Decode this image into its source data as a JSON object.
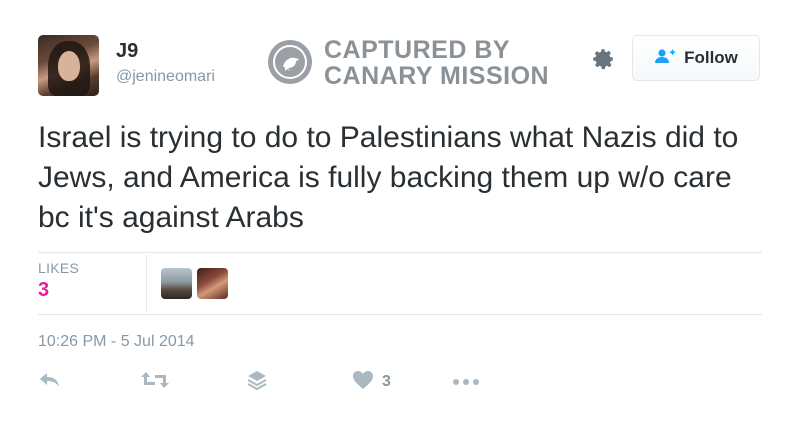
{
  "user": {
    "display_name": "J9",
    "handle": "@jenineomari"
  },
  "watermark": {
    "line1": "CAPTURED BY",
    "line2": "CANARY MISSION"
  },
  "follow_button": {
    "label": "Follow",
    "icon": "add-user-icon"
  },
  "tweet": {
    "text": "Israel is trying to do to Palestinians what Nazis did to Jews, and America is fully backing them up w/o care bc it's against Arabs",
    "likes_label": "LIKES",
    "likes_count": "3",
    "timestamp": "10:26 PM - 5 Jul 2014"
  },
  "actions": {
    "like_count": "3",
    "icons": [
      "reply-icon",
      "retweet-icon",
      "stack-icon",
      "heart-icon",
      "more-icon"
    ]
  },
  "colors": {
    "likes_count": "#e81c9c",
    "muted": "#8899a6",
    "text": "#292f33",
    "divider": "#e1e8ed",
    "follow_icon": "#1da1f2"
  }
}
